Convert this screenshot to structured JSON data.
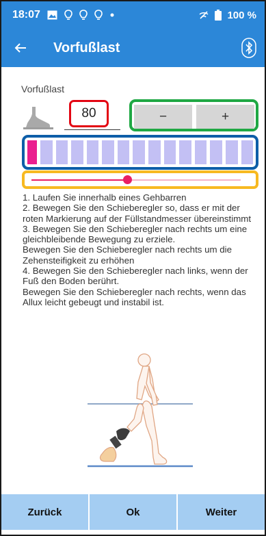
{
  "status_bar": {
    "time": "18:07",
    "battery": "100 %",
    "icons": [
      "gallery-icon",
      "bulb-icon",
      "bulb-icon",
      "bulb-icon",
      "dot-icon",
      "no-signal-icon",
      "battery-icon"
    ]
  },
  "app_bar": {
    "title": "Vorfußlast",
    "back_icon": "arrow-left-icon",
    "bluetooth_icon": "bluetooth-icon"
  },
  "section": {
    "label": "Vorfußlast",
    "value": "80",
    "minus_label": "−",
    "plus_label": "+"
  },
  "gauge": {
    "segment_count": 15,
    "marker_position": 0
  },
  "slider": {
    "value_fraction": 0.46
  },
  "instructions": {
    "text": "1. Laufen Sie innerhalb eines Gehbarren\n2. Bewegen Sie den Schieberegler so, dass er mit der roten Markierung auf der Füllstandmesser übereinstimmt\n3. Bewegen Sie den Schieberegler nach rechts  um eine gleichbleibende Bewegung zu erziele.\nBewegen Sie den Schieberegler nach rechts um die Zehensteifigkeit zu erhöhen\n4. Bewegen Sie den Schieberegler nach links, wenn der Fuß den Boden berührt.\nBewegen Sie den Schieberegler nach rechts, wenn das Allux leicht gebeugt und instabil ist."
  },
  "bottom_bar": {
    "back_label": "Zurück",
    "ok_label": "Ok",
    "next_label": "Weiter"
  },
  "colors": {
    "primary": "#2c87d8",
    "value_border": "#e30613",
    "stepper_border": "#1fa844",
    "gauge_border": "#0d5ea8",
    "slider_border": "#f7b921",
    "gauge_segment": "#c3c0f4",
    "gauge_marker": "#ea1f8f",
    "button_bg": "#a4cdf2"
  }
}
